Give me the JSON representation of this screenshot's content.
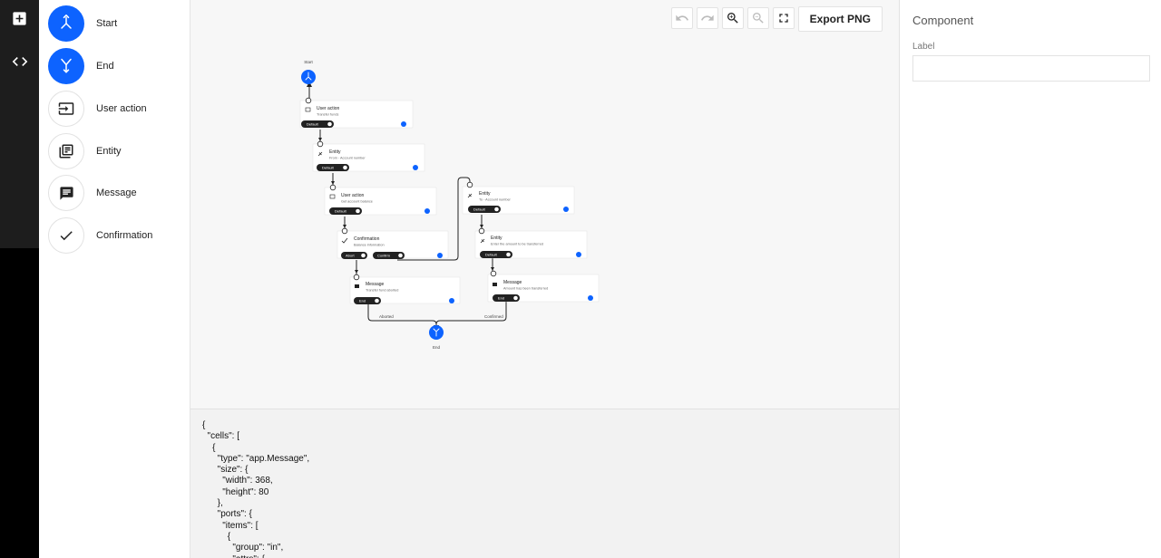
{
  "rail": {
    "items": [
      {
        "icon": "add-box-icon"
      },
      {
        "icon": "code-icon"
      }
    ]
  },
  "palette": {
    "items": [
      {
        "label": "Start",
        "icon": "start-icon",
        "style": "filled"
      },
      {
        "label": "End",
        "icon": "end-icon",
        "style": "filled"
      },
      {
        "label": "User action",
        "icon": "user-action-icon",
        "style": "outline"
      },
      {
        "label": "Entity",
        "icon": "entity-icon",
        "style": "outline"
      },
      {
        "label": "Message",
        "icon": "message-icon",
        "style": "outline"
      },
      {
        "label": "Confirmation",
        "icon": "confirmation-icon",
        "style": "outline"
      }
    ]
  },
  "toolbar": {
    "undo_icon": "undo-icon",
    "redo_icon": "redo-icon",
    "zoom_in_icon": "zoom-in-icon",
    "zoom_out_icon": "zoom-out-icon",
    "fit_icon": "fit-icon",
    "export_label": "Export PNG"
  },
  "colors": {
    "accent": "#0d63ff",
    "pill": "#222222",
    "rail": "#1d1d1d"
  },
  "diagram": {
    "start_label": "Start",
    "end_label": "End",
    "nodes": [
      {
        "title": "User action",
        "subtitle": "Transfer funds",
        "ports": [
          "Default"
        ]
      },
      {
        "title": "Entity",
        "subtitle": "From - Account number",
        "ports": [
          "Default"
        ]
      },
      {
        "title": "User action",
        "subtitle": "Get account balance",
        "ports": [
          "Default"
        ]
      },
      {
        "title": "Confirmation",
        "subtitle": "Balance information",
        "ports": [
          "Abort",
          "Confirm"
        ]
      },
      {
        "title": "Message",
        "subtitle": "Transfer fund aborted",
        "ports": [
          "End"
        ]
      },
      {
        "title": "Entity",
        "subtitle": "To - Account number",
        "ports": [
          "Default"
        ]
      },
      {
        "title": "Entity",
        "subtitle": "Enter the amount to be transferred",
        "ports": [
          "Default"
        ]
      },
      {
        "title": "Message",
        "subtitle": "Amount has been transferred",
        "ports": [
          "End"
        ]
      }
    ],
    "link_labels": [
      "Aborted",
      "Confirmed"
    ]
  },
  "json_text": "{\n  \"cells\": [\n    {\n      \"type\": \"app.Message\",\n      \"size\": {\n        \"width\": 368,\n        \"height\": 80\n      },\n      \"ports\": {\n        \"items\": [\n          {\n            \"group\": \"in\",\n            \"attrs\": {",
  "inspector": {
    "title": "Component",
    "label_caption": "Label",
    "label_value": ""
  }
}
